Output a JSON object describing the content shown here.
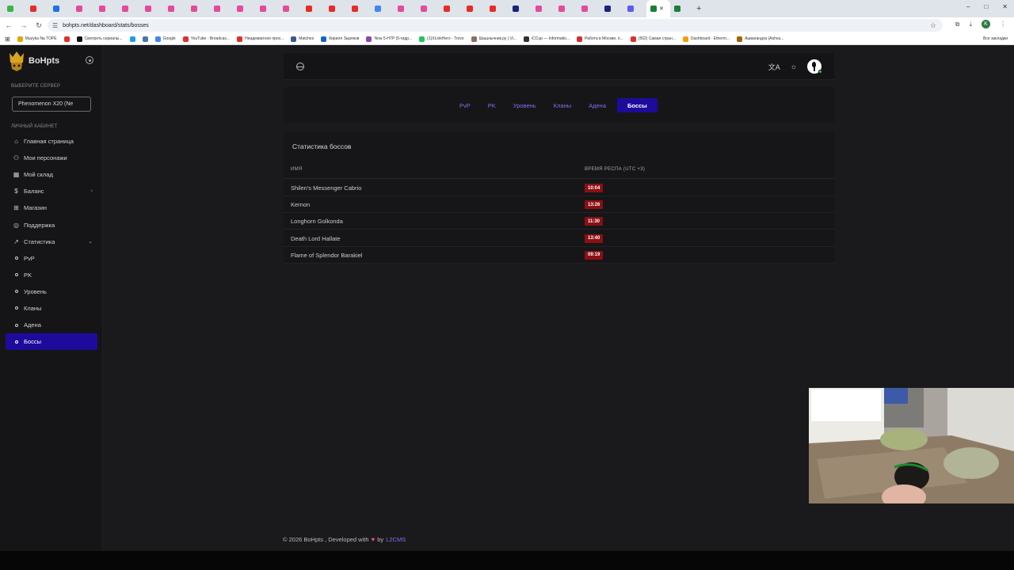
{
  "browser": {
    "tabs_count": 30,
    "url": "bohpts.net/dashboard/stats/bosses",
    "profile_initial": "K",
    "bookmarks": [
      {
        "label": "Muzyka Na TOPE",
        "color": "#e1a700"
      },
      {
        "label": "",
        "color": "#e52d27"
      },
      {
        "label": "Смотреть сериалы...",
        "color": "#111111"
      },
      {
        "label": "",
        "color": "#1d9bf0"
      },
      {
        "label": "",
        "color": "#4a76a8"
      },
      {
        "label": "Google",
        "color": "#4285f4"
      },
      {
        "label": "YouTube - Broadcas...",
        "color": "#e52d27"
      },
      {
        "label": "Неадекватное прох...",
        "color": "#e52d27"
      },
      {
        "label": "Matches",
        "color": "#3a5a8c"
      },
      {
        "label": "Кирилл Зыряков",
        "color": "#1565c0"
      },
      {
        "label": "Now 5-HTP (5-гидр...",
        "color": "#8e44ad"
      },
      {
        "label": "(1)XLinkHero - Trovo",
        "color": "#22c55e"
      },
      {
        "label": "Шашлычник.ру | Vi...",
        "color": "#8d6e63"
      },
      {
        "label": "iCCup — Informatio...",
        "color": "#333333"
      },
      {
        "label": "Работа в Москве, п...",
        "color": "#d32f2f"
      },
      {
        "label": "(562) Самая стран...",
        "color": "#e52d27"
      },
      {
        "label": "Dashboard - Etherm...",
        "color": "#f59e0b"
      },
      {
        "label": "Ашвагандха (Ashva...",
        "color": "#a16207"
      }
    ],
    "bookmarks_all": "Все закладки"
  },
  "sidebar": {
    "logo_text": "BoHpts",
    "server_section_label": "ВЫБЕРИТЕ СЕРВЕР",
    "server_selected": "Phenomenon X20 (Ne",
    "cabinet_section_label": "ЛИЧНЫЙ КАБИНЕТ",
    "items": [
      {
        "label": "Главная страница",
        "icon": "home-icon",
        "glyph": "⌂"
      },
      {
        "label": "Мои персонажи",
        "icon": "users-icon",
        "glyph": "⚇"
      },
      {
        "label": "Мой склад",
        "icon": "warehouse-icon",
        "glyph": "▦"
      },
      {
        "label": "Баланс",
        "icon": "coin-icon",
        "glyph": "$"
      },
      {
        "label": "Магазин",
        "icon": "shop-icon",
        "glyph": "⊞"
      },
      {
        "label": "Поддержка",
        "icon": "support-icon",
        "glyph": "◎"
      },
      {
        "label": "Статистика",
        "icon": "chart-icon",
        "glyph": "↗"
      }
    ],
    "stats_sub": [
      "PvP",
      "PK",
      "Уровень",
      "Кланы",
      "Адена",
      "Боссы"
    ],
    "active_sub": "Боссы"
  },
  "stats_tabs": [
    "PvP",
    "PK",
    "Уровень",
    "Кланы",
    "Адена",
    "Боссы"
  ],
  "active_tab": "Боссы",
  "boss_stats": {
    "title": "Статистика боссов",
    "col_name": "ИМЯ",
    "col_time": "ВРЕМЯ РЕСПА (UTC +3)",
    "rows": [
      {
        "name": "Shilen's Messenger Cabrio",
        "time": "10:04"
      },
      {
        "name": "Kernon",
        "time": "13:26"
      },
      {
        "name": "Longhorn Golkonda",
        "time": "11:30"
      },
      {
        "name": "Death Lord Hallate",
        "time": "13:40"
      },
      {
        "name": "Flame of Splendor Barakiel",
        "time": "09:19"
      }
    ]
  },
  "footer": {
    "copyright": "© 2026 BoHpts , Developed with",
    "by": "by",
    "link": "L2CMS"
  },
  "colors": {
    "accent": "#1e0b9b",
    "link": "#7b73f2",
    "respawn_badge": "#8b0f14"
  }
}
